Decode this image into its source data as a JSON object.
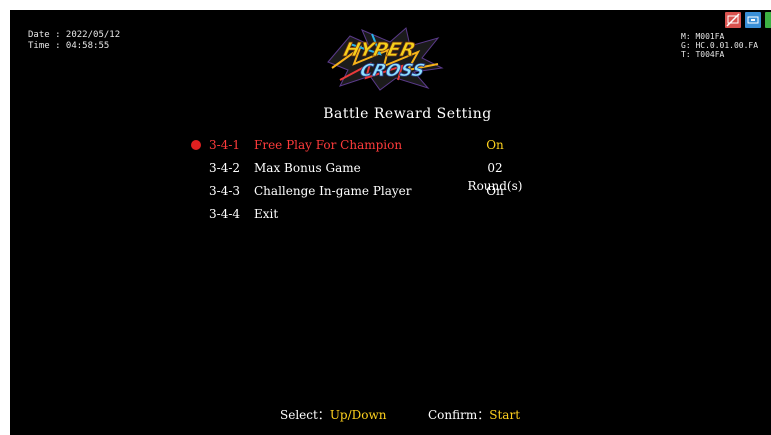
{
  "info": {
    "date_label": "Date : 2022/05/12",
    "time_label": "Time : 04:58:55",
    "machine": "M: M001FA",
    "game_version": "G: HC.0.01.00.FA",
    "terminal": "T: T004FA"
  },
  "logo": {
    "top_text": "HYPER",
    "bottom_text": "CROSS"
  },
  "status_icons": [
    {
      "name": "network-off-icon",
      "color": "#d9534f"
    },
    {
      "name": "link-icon",
      "color": "#3a8fd6"
    },
    {
      "name": "power-icon",
      "color": "#3cb043"
    }
  ],
  "screen_title": "Battle Reward Setting",
  "menu": [
    {
      "code": "3-4-1",
      "label": "Free Play For Champion",
      "value": "On",
      "selected": true
    },
    {
      "code": "3-4-2",
      "label": "Max Bonus Game",
      "value": "02 Round(s)",
      "selected": false
    },
    {
      "code": "3-4-3",
      "label": "Challenge In-game Player",
      "value": "On",
      "selected": false
    },
    {
      "code": "3-4-4",
      "label": "Exit",
      "value": "",
      "selected": false
    }
  ],
  "footer": {
    "select_label": "Select：",
    "select_action": "Up/Down",
    "confirm_label": "Confirm：",
    "confirm_action": "Start"
  },
  "colors": {
    "background": "#000000",
    "selected_text": "#ff3b3b",
    "value_highlight": "#ffd21e",
    "normal_text": "#ffffff"
  }
}
